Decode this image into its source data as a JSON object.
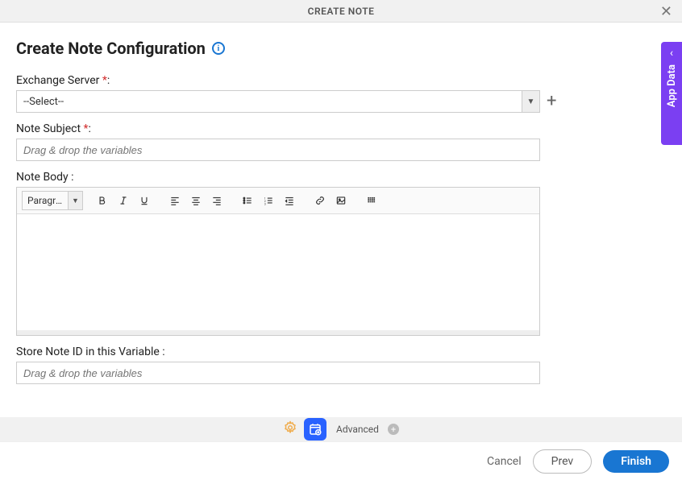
{
  "header": {
    "title": "CREATE NOTE"
  },
  "page": {
    "title": "Create Note Configuration"
  },
  "fields": {
    "exchange_server": {
      "label": "Exchange Server",
      "required": "*",
      "colon": ":",
      "value": "--Select--"
    },
    "note_subject": {
      "label": "Note Subject",
      "required": "*",
      "colon": ":",
      "placeholder": "Drag & drop the variables"
    },
    "note_body": {
      "label": "Note Body :",
      "paragraph_option": "Paragra…"
    },
    "store_note_id": {
      "label": "Store Note ID in this Variable :",
      "placeholder": "Drag & drop the variables"
    }
  },
  "sidebar": {
    "label": "App Data"
  },
  "footer": {
    "advanced_label": "Advanced"
  },
  "actions": {
    "cancel": "Cancel",
    "prev": "Prev",
    "finish": "Finish"
  },
  "icons": {
    "info": "i",
    "plus": "+",
    "caret": "▼",
    "chevron_left": "‹"
  }
}
